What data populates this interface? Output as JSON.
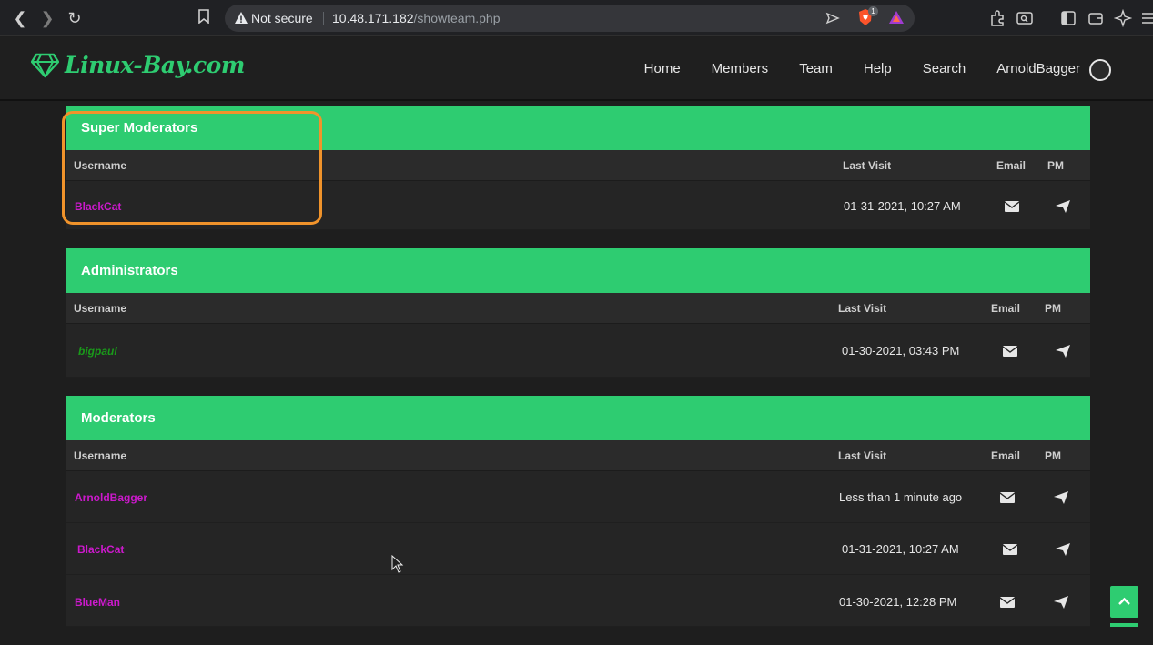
{
  "browser": {
    "not_secure": "Not secure",
    "url_host": "10.48.171.182",
    "url_path": "/showteam.php",
    "brave_badge": "1"
  },
  "site": {
    "logo_text": "Linux-Bay.com",
    "brand_color": "#2ecc71",
    "nav": [
      "Home",
      "Members",
      "Team",
      "Help",
      "Search",
      "ArnoldBagger"
    ]
  },
  "columns": {
    "username": "Username",
    "last_visit": "Last Visit",
    "email": "Email",
    "pm": "PM"
  },
  "groups": [
    {
      "title": "Super Moderators",
      "members": [
        {
          "username": "BlackCat",
          "last_visit": "01-31-2021, 10:27 AM"
        }
      ]
    },
    {
      "title": "Administrators",
      "members": [
        {
          "username": "bigpaul",
          "last_visit": "01-30-2021, 03:43 PM"
        }
      ]
    },
    {
      "title": "Moderators",
      "members": [
        {
          "username": "ArnoldBagger",
          "last_visit": "Less than 1 minute ago"
        },
        {
          "username": "BlackCat",
          "last_visit": "01-31-2021, 10:27 AM"
        },
        {
          "username": "BlueMan",
          "last_visit": "01-30-2021, 12:28 PM"
        }
      ]
    }
  ]
}
